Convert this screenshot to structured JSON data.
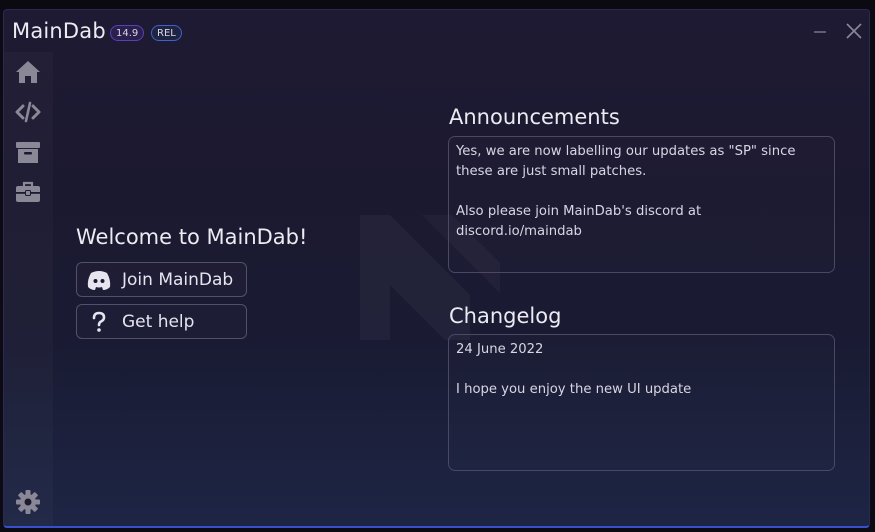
{
  "window": {
    "title": "MainDab",
    "version_badge": "14.9",
    "release_badge": "REL"
  },
  "sidebar": {
    "items": [
      {
        "name": "home",
        "icon": "home-icon"
      },
      {
        "name": "editor",
        "icon": "code-icon"
      },
      {
        "name": "scripts",
        "icon": "archive-icon"
      },
      {
        "name": "tools",
        "icon": "toolbox-icon"
      }
    ],
    "settings_icon": "gear-icon"
  },
  "home": {
    "welcome": "Welcome to MainDab!",
    "join_button": "Join MainDab",
    "help_button": "Get help"
  },
  "announcements": {
    "title": "Announcements",
    "text": "Yes, we are now labelling our updates as \"SP\" since these are just small patches.\n\nAlso please join MainDab's discord at discord.io/maindab"
  },
  "changelog": {
    "title": "Changelog",
    "text": "24 June 2022\n\nI hope you enjoy the new UI update"
  },
  "colors": {
    "accent_purple": "#5b3fb8",
    "accent_blue": "#3a4fd0",
    "icon_gray": "#8a8896"
  }
}
